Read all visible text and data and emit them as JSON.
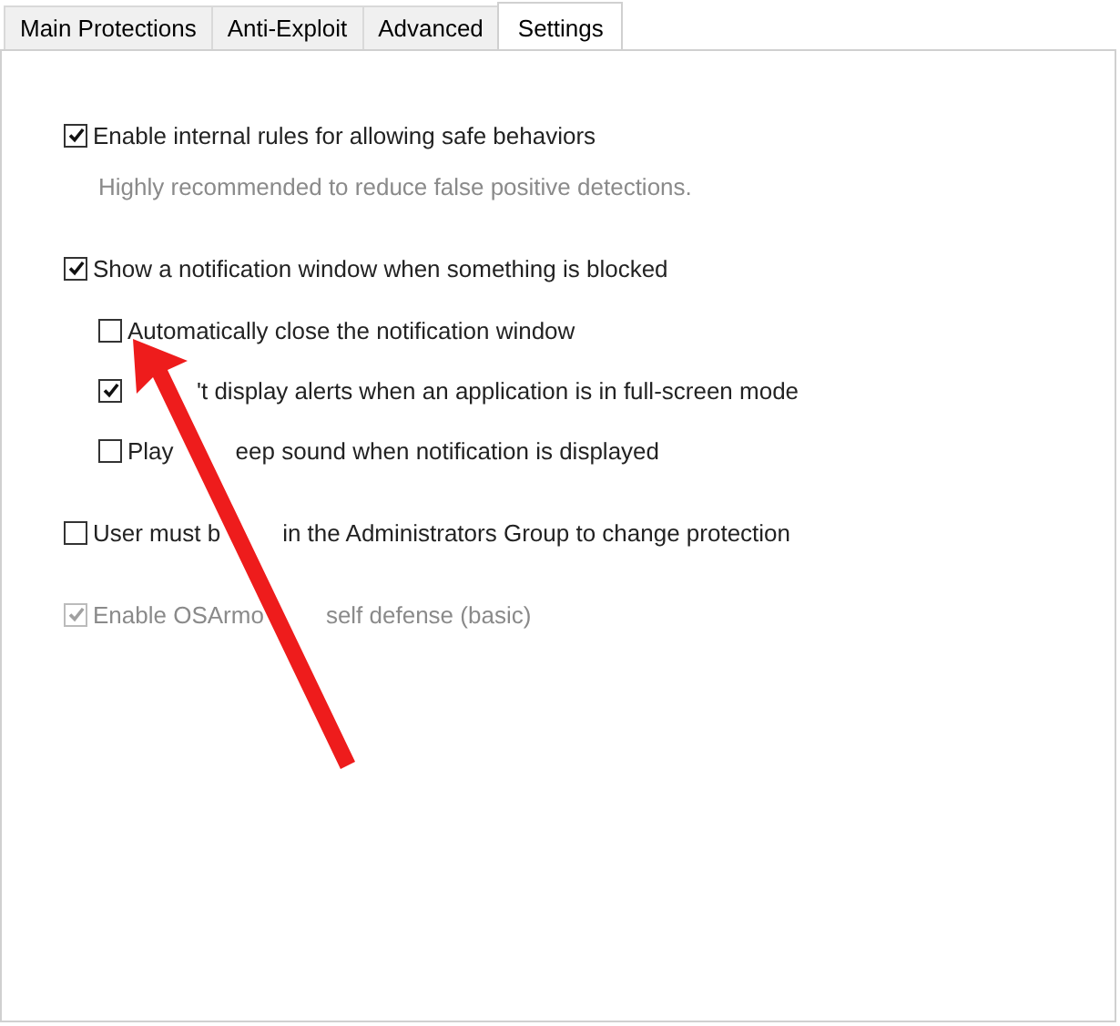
{
  "tabs": [
    {
      "label": "Main Protections",
      "selected": false
    },
    {
      "label": "Anti-Exploit",
      "selected": false
    },
    {
      "label": "Advanced",
      "selected": false
    },
    {
      "label": "Settings",
      "selected": true
    }
  ],
  "options": [
    {
      "label": "Enable internal rules for allowing safe behaviors",
      "checked": true,
      "disabled": false,
      "hint": "Highly recommended to reduce false positive detections."
    },
    {
      "label": "Show a notification window when something is blocked",
      "checked": true,
      "disabled": false,
      "children": [
        {
          "label": "Automatically close the notification window",
          "checked": false,
          "disabled": false
        },
        {
          "label": {
            "after": "'t display alerts when an application is in full-screen mode"
          },
          "checked": true,
          "disabled": false
        },
        {
          "label": {
            "before": "Play",
            "after": "eep sound when notification is displayed"
          },
          "checked": false,
          "disabled": false
        }
      ]
    },
    {
      "label": {
        "before": "User must b",
        "after": "in the Administrators Group to change protection"
      },
      "checked": false,
      "disabled": false
    },
    {
      "label": {
        "before": "Enable OSArmo",
        "after": "self defense (basic)"
      },
      "checked": true,
      "disabled": true
    }
  ]
}
